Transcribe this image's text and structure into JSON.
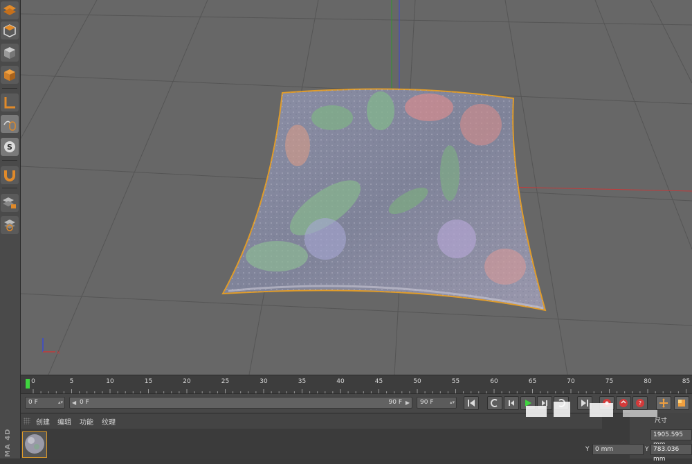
{
  "app": {
    "brand_text": "MA 4D"
  },
  "toolbar": {
    "tools": [
      {
        "name": "checker-grid-icon"
      },
      {
        "name": "cube-outline-icon"
      },
      {
        "name": "cube-gray-icon"
      },
      {
        "name": "cube-orange-icon"
      },
      {
        "name": "l-shape-icon"
      },
      {
        "name": "mouse-icon"
      },
      {
        "name": "s-circle-icon"
      },
      {
        "name": "magnet-icon"
      },
      {
        "name": "grid-lock-icon"
      },
      {
        "name": "grid-refresh-icon"
      }
    ]
  },
  "timeline": {
    "ticks": [
      "0",
      "5",
      "10",
      "15",
      "20",
      "25",
      "30",
      "35",
      "40",
      "45",
      "50",
      "55",
      "60",
      "65",
      "70",
      "75",
      "80",
      "85"
    ]
  },
  "transport": {
    "current_frame": "0 F",
    "range_start": "0 F",
    "range_end": "90 F",
    "end_frame": "90 F"
  },
  "material_manager": {
    "menu": [
      "创建",
      "编辑",
      "功能",
      "纹理"
    ]
  },
  "coordinates": {
    "size_header": "尺寸",
    "size_x_value": "1905.595 mm",
    "pos_y_label": "Y",
    "pos_y_value": "0 mm",
    "size_y_label": "Y",
    "size_y_value": "783.036 mm"
  },
  "colors": {
    "viewport_bg": "#676767",
    "grid_line": "#4e4e4e",
    "axis_x": "#c43a3a",
    "axis_y": "#2d9a2d",
    "axis_z": "#3a4ad4",
    "selection_outline": "#e09c2a",
    "playhead": "#3fd43f"
  }
}
